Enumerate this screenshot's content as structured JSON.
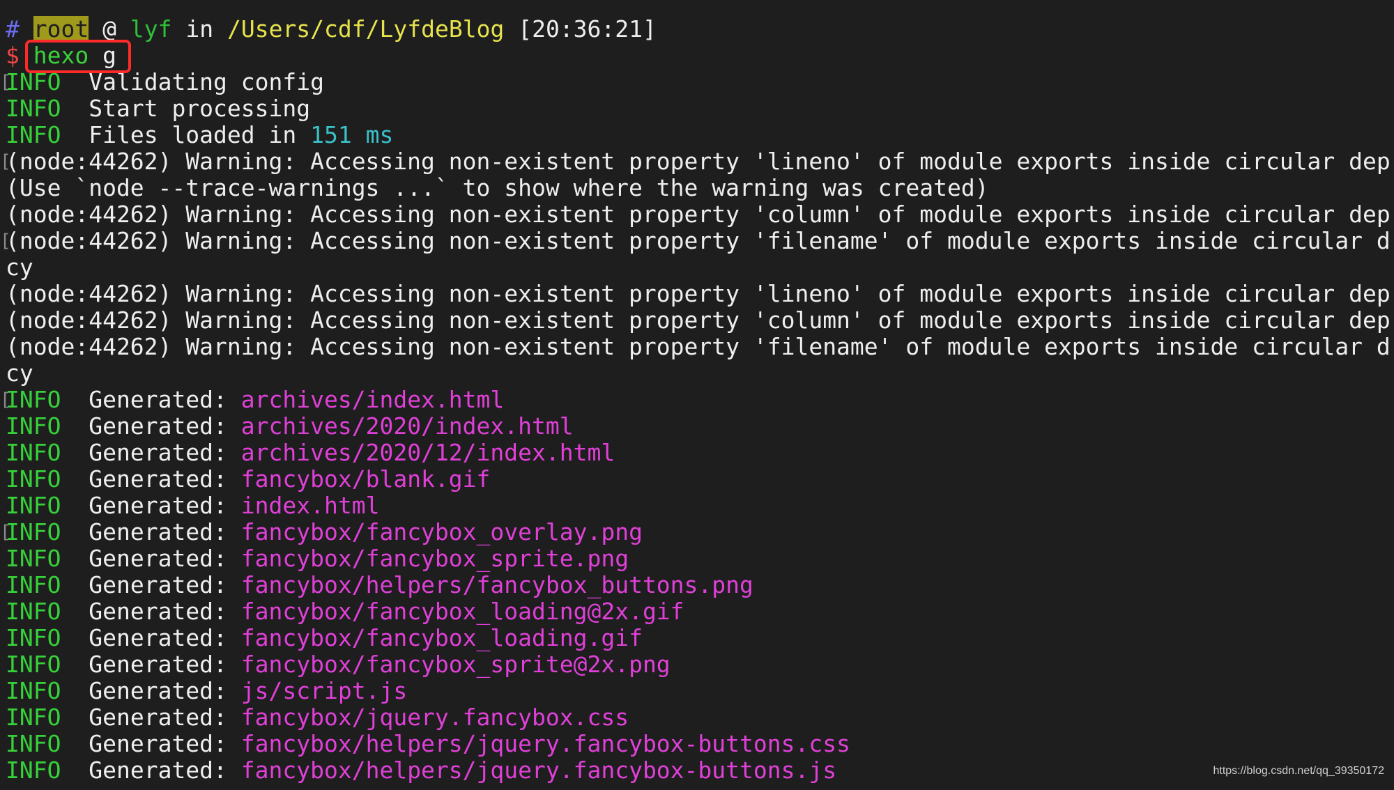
{
  "prompt": {
    "hash": "#",
    "user": "root",
    "at": "@",
    "host": "lyf",
    "in": "in",
    "path": "/Users/cdf/LyfdeBlog",
    "time": "[20:36:21]",
    "dollar": "$",
    "command": "hexo",
    "argument": "g"
  },
  "info_label": "INFO",
  "info_lines": [
    {
      "text": "Validating config",
      "marker": true
    },
    {
      "text": "Start processing",
      "marker": false
    }
  ],
  "files_loaded": {
    "text": "Files loaded in ",
    "value": "151 ms"
  },
  "warnings": [
    {
      "text": "(node:44262) Warning: Accessing non-existent property 'lineno' of module exports inside circular dep",
      "marker": true
    },
    {
      "text": "(Use `node --trace-warnings ...` to show where the warning was created)",
      "marker": false
    },
    {
      "text": "(node:44262) Warning: Accessing non-existent property 'column' of module exports inside circular dep",
      "marker": false
    },
    {
      "text": "(node:44262) Warning: Accessing non-existent property 'filename' of module exports inside circular d",
      "marker": true
    },
    {
      "text": "cy",
      "marker": false
    },
    {
      "text": "(node:44262) Warning: Accessing non-existent property 'lineno' of module exports inside circular dep",
      "marker": false
    },
    {
      "text": "(node:44262) Warning: Accessing non-existent property 'column' of module exports inside circular dep",
      "marker": false
    },
    {
      "text": "(node:44262) Warning: Accessing non-existent property 'filename' of module exports inside circular d",
      "marker": false
    },
    {
      "text": "cy",
      "marker": false
    }
  ],
  "generated_label": "Generated: ",
  "generated": [
    {
      "file": "archives/index.html",
      "marker": true
    },
    {
      "file": "archives/2020/index.html",
      "marker": false
    },
    {
      "file": "archives/2020/12/index.html",
      "marker": false
    },
    {
      "file": "fancybox/blank.gif",
      "marker": false
    },
    {
      "file": "index.html",
      "marker": false
    },
    {
      "file": "fancybox/fancybox_overlay.png",
      "marker": true
    },
    {
      "file": "fancybox/fancybox_sprite.png",
      "marker": false
    },
    {
      "file": "fancybox/helpers/fancybox_buttons.png",
      "marker": false
    },
    {
      "file": "fancybox/fancybox_loading@2x.gif",
      "marker": false
    },
    {
      "file": "fancybox/fancybox_loading.gif",
      "marker": false
    },
    {
      "file": "fancybox/fancybox_sprite@2x.png",
      "marker": false
    },
    {
      "file": "js/script.js",
      "marker": false
    },
    {
      "file": "fancybox/jquery.fancybox.css",
      "marker": false
    },
    {
      "file": "fancybox/helpers/jquery.fancybox-buttons.css",
      "marker": false
    },
    {
      "file": "fancybox/helpers/jquery.fancybox-buttons.js",
      "marker": false
    }
  ],
  "watermark": "https://blog.csdn.net/qq_39350172",
  "colors": {
    "background": "#1e1e1e",
    "info": "#36d13a",
    "file": "#e040d8",
    "number": "#3ac0c9",
    "path": "#e7e34d",
    "highlight": "#ff2a2a"
  }
}
